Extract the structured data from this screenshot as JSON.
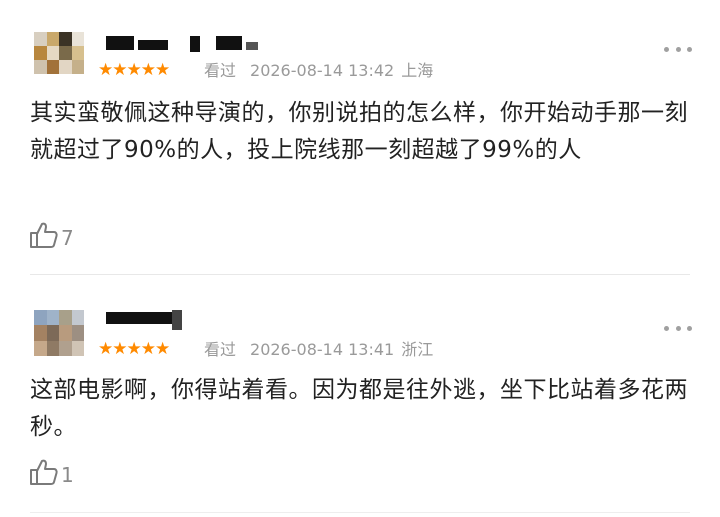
{
  "reviews": [
    {
      "stars": "★★★★★",
      "status": "看过",
      "datetime": "2026-08-14 13:42",
      "location": "上海",
      "text": "其实蛮敬佩这种导演的，你别说拍的怎么样，你开始动手那一刻就超过了90%的人，投上院线那一刻超越了99%的人",
      "likes": "7",
      "icons": {
        "like": "thumbs-up-icon",
        "more": "more-dots-icon"
      }
    },
    {
      "stars": "★★★★★",
      "status": "看过",
      "datetime": "2026-08-14 13:41",
      "location": "浙江",
      "text": "这部电影啊，你得站着看。因为都是往外逃，坐下比站着多花两秒。",
      "likes": "1",
      "icons": {
        "like": "thumbs-up-icon",
        "more": "more-dots-icon"
      }
    }
  ],
  "colors": {
    "star": "#ff8a00",
    "meta": "#9a9a9a",
    "text": "#222222",
    "divider": "#e8e8e8"
  }
}
